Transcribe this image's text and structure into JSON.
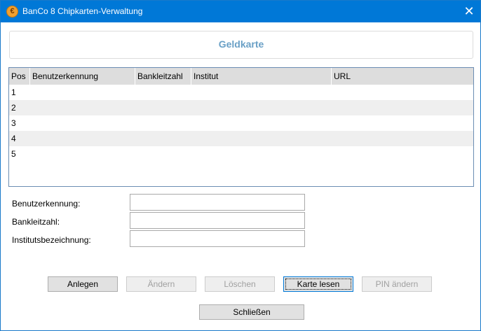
{
  "window": {
    "title": "BanCo 8 Chipkarten-Verwaltung",
    "close_glyph": "✕",
    "icon_glyph": "€"
  },
  "heading": "Geldkarte",
  "grid": {
    "columns": [
      "Pos",
      "Benutzerkennung",
      "Bankleitzahl",
      "Institut",
      "URL"
    ],
    "rows": [
      "1",
      "2",
      "3",
      "4",
      "5"
    ]
  },
  "form": {
    "benutzerkennung_label": "Benutzerkennung:",
    "benutzerkennung_value": "",
    "bankleitzahl_label": "Bankleitzahl:",
    "bankleitzahl_value": "",
    "institut_label": "Institutsbezeichnung:",
    "institut_value": ""
  },
  "buttons": {
    "anlegen": "Anlegen",
    "aendern": "Ändern",
    "loeschen": "Löschen",
    "karte_lesen": "Karte lesen",
    "pin_aendern": "PIN ändern",
    "schliessen": "Schließen"
  }
}
